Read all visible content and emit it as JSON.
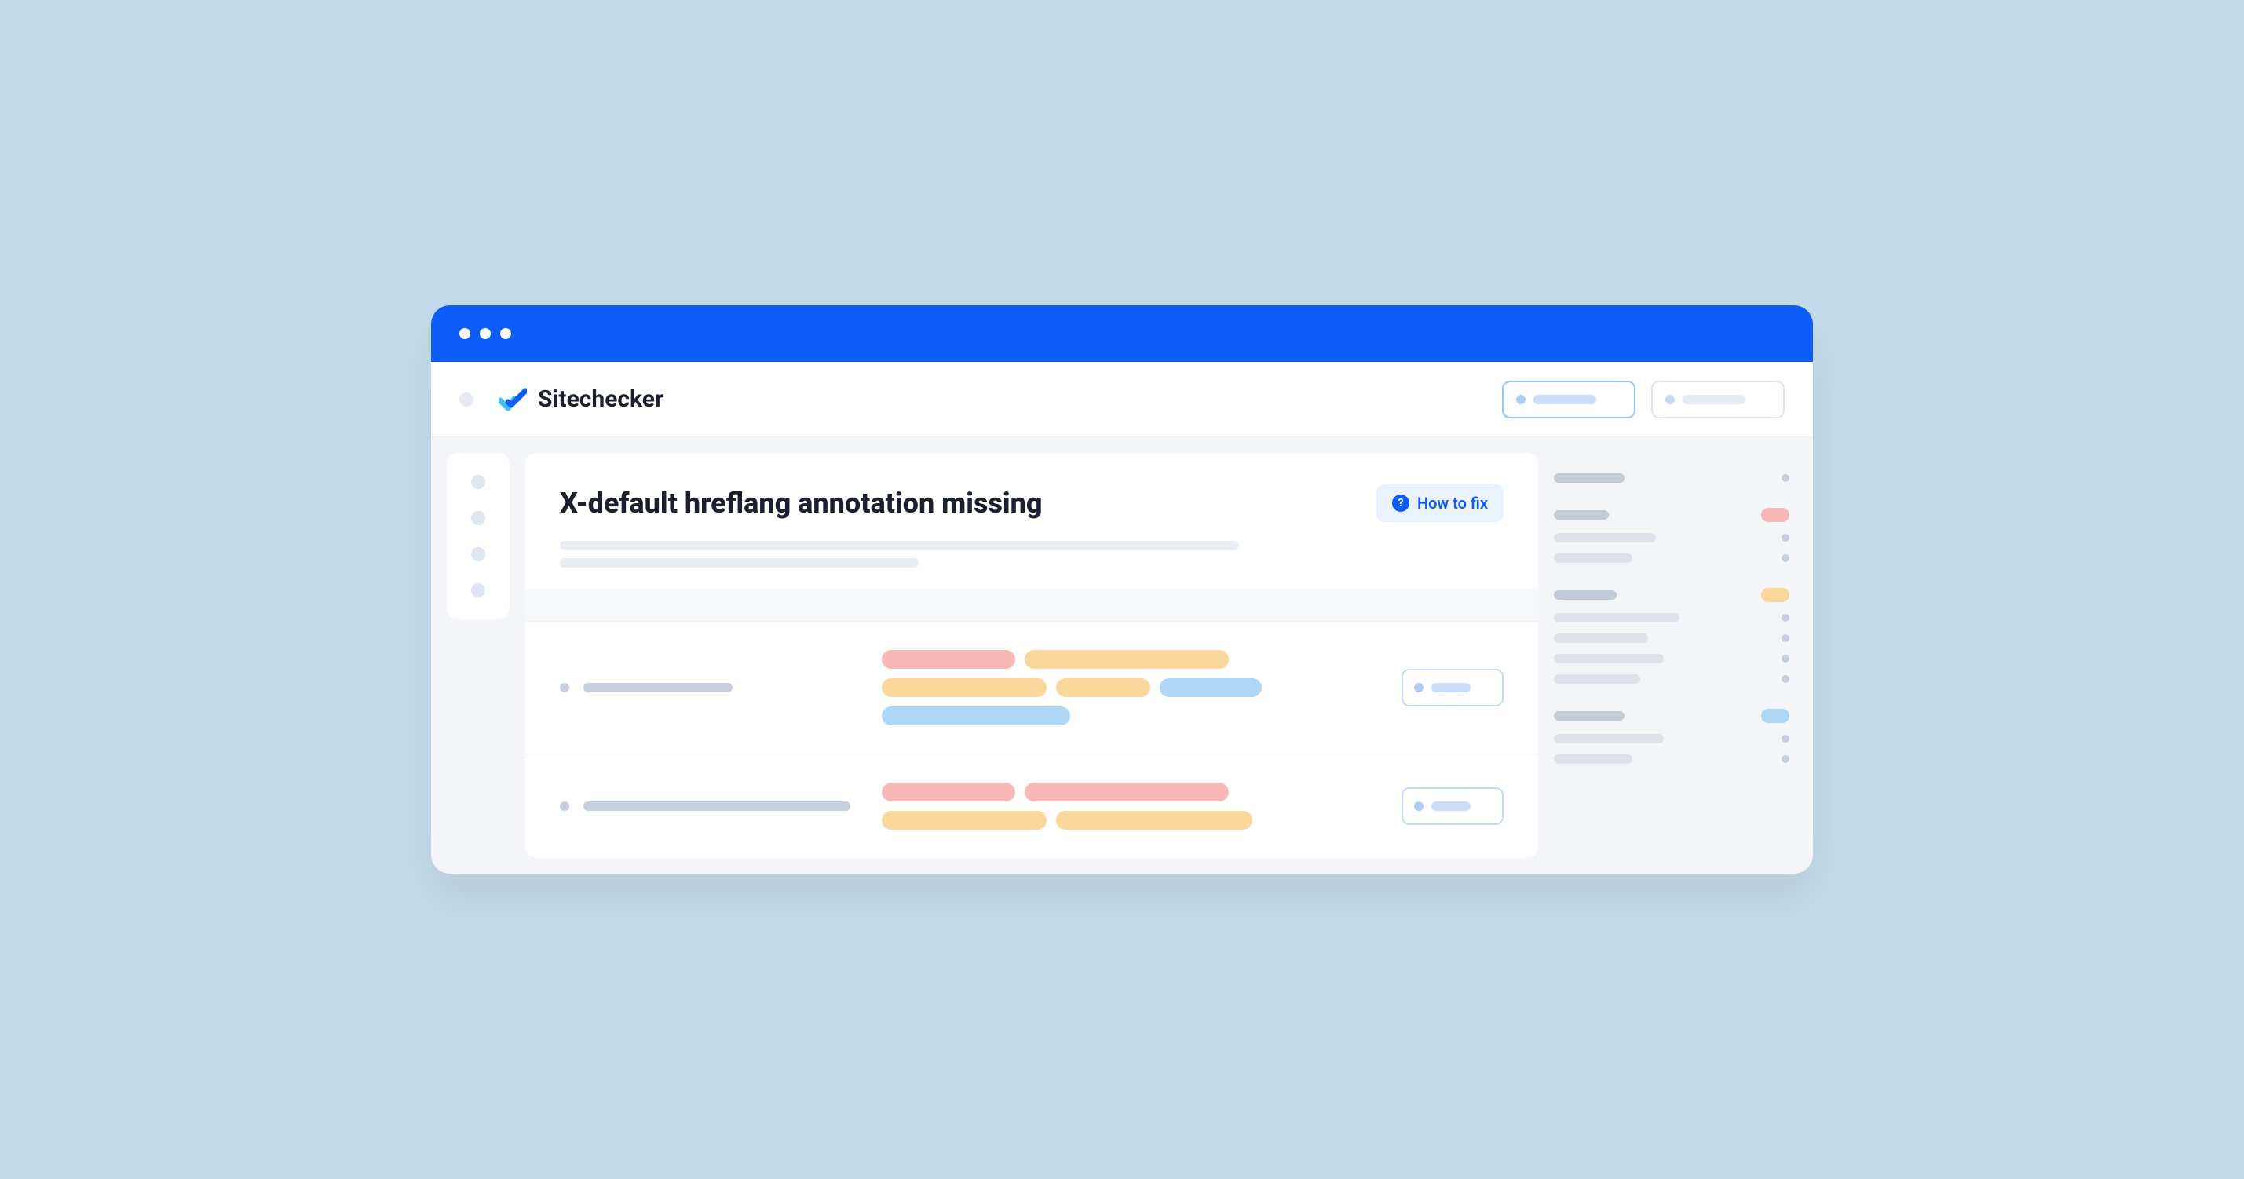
{
  "brand": {
    "name": "Sitechecker"
  },
  "report": {
    "title": "X-default hreflang annotation missing",
    "how_to_fix_label": "How to fix"
  },
  "colors": {
    "primary": "#0D5CF7",
    "tag_red": "#F8B9B8",
    "tag_yellow": "#FAD89B",
    "tag_blue": "#AFD6F4"
  }
}
